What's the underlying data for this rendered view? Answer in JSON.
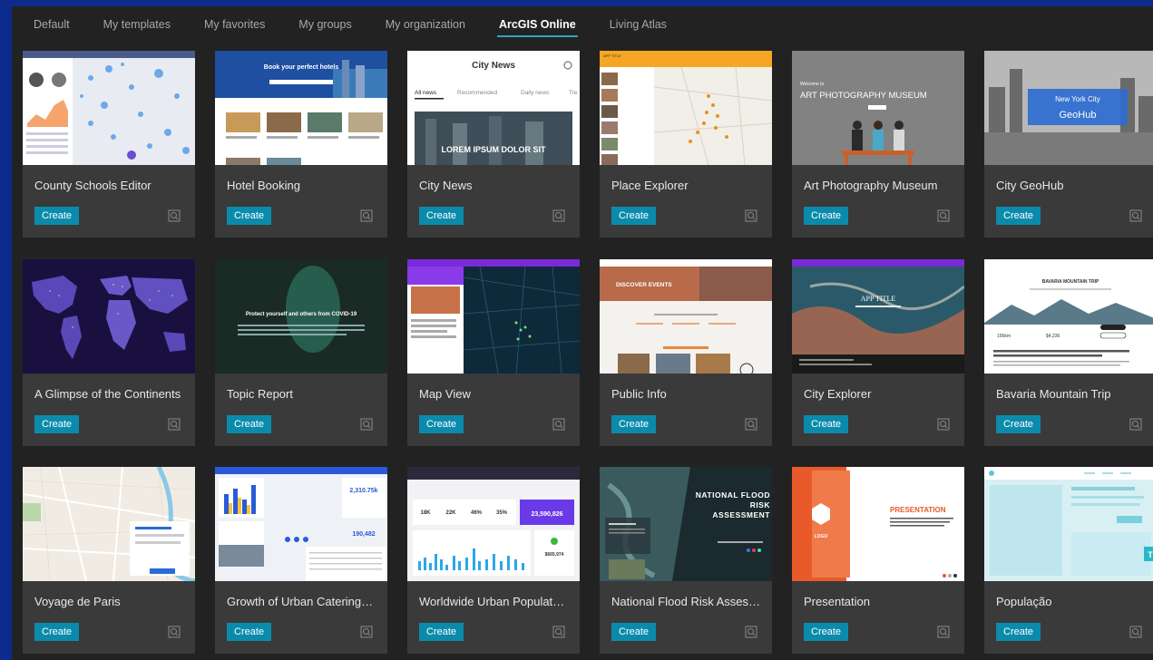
{
  "tabs": [
    {
      "label": "Default",
      "active": false
    },
    {
      "label": "My templates",
      "active": false
    },
    {
      "label": "My favorites",
      "active": false
    },
    {
      "label": "My groups",
      "active": false
    },
    {
      "label": "My organization",
      "active": false
    },
    {
      "label": "ArcGIS Online",
      "active": true
    },
    {
      "label": "Living Atlas",
      "active": false
    }
  ],
  "create_label": "Create",
  "cards": [
    {
      "title": "County Schools Editor"
    },
    {
      "title": "Hotel Booking",
      "thumb_text": "Book your perfect hotels"
    },
    {
      "title": "City News",
      "thumb_title": "City News",
      "thumb_tabs": [
        "All news",
        "Recommended",
        "Daily news",
        "Tre"
      ],
      "thumb_caption": "LOREM IPSUM DOLOR SIT"
    },
    {
      "title": "Place Explorer",
      "thumb_text": "APP TITLE"
    },
    {
      "title": "Art Photography Museum",
      "thumb_small": "Welcome to",
      "thumb_text": "ART PHOTOGRAPHY MUSEUM"
    },
    {
      "title": "City GeoHub",
      "thumb_small": "New York City",
      "thumb_text": "GeoHub"
    },
    {
      "title": "A Glimpse of the Continents"
    },
    {
      "title": "Topic Report",
      "thumb_text": "Protect yourself and others from COVID-19"
    },
    {
      "title": "Map View"
    },
    {
      "title": "Public Info",
      "thumb_text": "DISCOVER EVENTS"
    },
    {
      "title": "City Explorer",
      "thumb_text": "APP TITLE"
    },
    {
      "title": "Bavaria Mountain Trip",
      "thumb_text": "BAVARIA MOUNTAIN TRIP",
      "thumb_stats": [
        "156km",
        "$4,236"
      ]
    },
    {
      "title": "Voyage de Paris"
    },
    {
      "title": "Growth of Urban Catering…",
      "thumb_stats": [
        "2,310.75k",
        "190,482"
      ]
    },
    {
      "title": "Worldwide Urban Populat…",
      "thumb_stats": [
        "18K",
        "22K",
        "46%",
        "35%",
        "23,590,826",
        "$665,974"
      ]
    },
    {
      "title": "National Flood Risk Asses…",
      "thumb_text": "NATIONAL FLOOD RISK ASSESSMENT"
    },
    {
      "title": "Presentation",
      "thumb_text": "PRESENTATION",
      "thumb_small": "LOGO"
    },
    {
      "title": "População"
    }
  ],
  "colors": {
    "page_bg": "#0d2b8c",
    "panel_bg": "#222222",
    "card_bg": "#3a3a3a",
    "accent": "#0b8bab",
    "tab_underline": "#2ea4c9"
  },
  "icons": {
    "preview": "preview-magnifier-icon"
  }
}
